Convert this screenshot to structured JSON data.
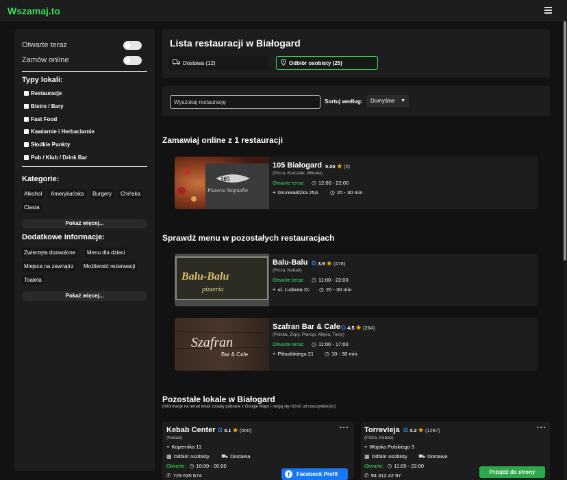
{
  "app": {
    "logo": "Wszamaj.to"
  },
  "sidebar": {
    "toggles": [
      {
        "label": "Otwarte teraz"
      },
      {
        "label": "Zamów online"
      }
    ],
    "types_heading": "Typy lokali:",
    "types": [
      "Restauracje",
      "Bistro / Bary",
      "Fast Food",
      "Kawiarnie i Herbaciarnie",
      "Słodkie Punkty",
      "Pub / Klub / Drink Bar"
    ],
    "categories_heading": "Kategorie:",
    "categories": [
      "Alkohol",
      "Amerykańska",
      "Burgery",
      "Chińska",
      "Ciasta"
    ],
    "show_more": "Pokaż więcej...",
    "extra_heading": "Dodatkowe informacje:",
    "extras": [
      "Zwierzęta dozwolone",
      "Menu dla dzieci",
      "Miejsca na zewnątrz",
      "Możliwość rezerwacji",
      "Toaleta"
    ],
    "show_more_2": "Pokaż więcej..."
  },
  "header": {
    "title": "Lista restauracji w Białogard",
    "tabs": [
      {
        "label": "Dostawa (12)",
        "icon": "truck-icon"
      },
      {
        "label": "Odbiór osobisty  (25)",
        "icon": "location-pin-icon"
      }
    ]
  },
  "search": {
    "placeholder": "Wyszukaj restaurację",
    "sort_label": "Sortuj według:",
    "sort_value": "Domyślne"
  },
  "section_online": {
    "title": "Zamawiaj online z 1 restauracji"
  },
  "online": [
    {
      "name": "105 Białogard",
      "rating": "5.00",
      "reviews": "(2)",
      "cuisine": "(Pizza, Kurczaki, Włoska)",
      "status": "Otwarte teraz",
      "hours": "12:00 - 22:00",
      "address": "Grunwaldzka 25A",
      "delivery_time": "20 - 30 min"
    }
  ],
  "section_menu": {
    "title": "Sprawdź menu w pozostałych restauracjach"
  },
  "menu_restaurants": [
    {
      "name": "Balu-Balu",
      "rating": "3.9",
      "reviews": "(478)",
      "cuisine": "(Pizza, Kebab)",
      "status": "Otwarte teraz",
      "hours": "11:00 - 22:00",
      "address": "ul. Ludowa 2c",
      "delivery_time": "20 - 30 min",
      "thumb_text": "Balu-Balu",
      "thumb_sub": "pizzeria"
    },
    {
      "name": "Szafran Bar & Cafe",
      "rating": "4.5",
      "reviews": "(264)",
      "cuisine": "(Polska, Zupy, Pierogi, Mięsa, Tosty)",
      "status": "Otwarte teraz",
      "hours": "11:00 - 17:00",
      "address": "Piłsudskiego 21",
      "delivery_time": "10 - 30 min",
      "thumb_text": "Szafran",
      "thumb_sub": "Bar & Cafe"
    }
  ],
  "section_other": {
    "title": "Pozostałe lokale w Białogard",
    "note": "(Informacje na temat lokali zostały pobrane z Google Maps i mogą się różnić od rzeczywistości)"
  },
  "other": [
    {
      "name": "Kebab Center",
      "rating": "4.1",
      "reviews": "(560)",
      "cuisine": "(Kebab)",
      "address": "Kopernika 11",
      "pickup": "Odbiór osobisty",
      "delivery": "Dostawa",
      "status": "Otwarte:",
      "hours": "10:00 - 00:00",
      "phone": "729 635 674",
      "button": "Facebook Profil"
    },
    {
      "name": "Torrevieja",
      "rating": "4.2",
      "reviews": "(1287)",
      "cuisine": "(Pizza, Kebab)",
      "address": "Wojska Polskiego 3",
      "pickup": "Odbiór osobisty",
      "delivery": "Dostawa",
      "status": "Otwarte:",
      "hours": "11:00 - 22:00",
      "phone": "94 312 42 97",
      "button": "Przejdź do strony"
    }
  ],
  "colors": {
    "accent": "#3ddc5a",
    "star": "#f5b400",
    "facebook": "#1877f2",
    "website": "#2ea84a"
  }
}
